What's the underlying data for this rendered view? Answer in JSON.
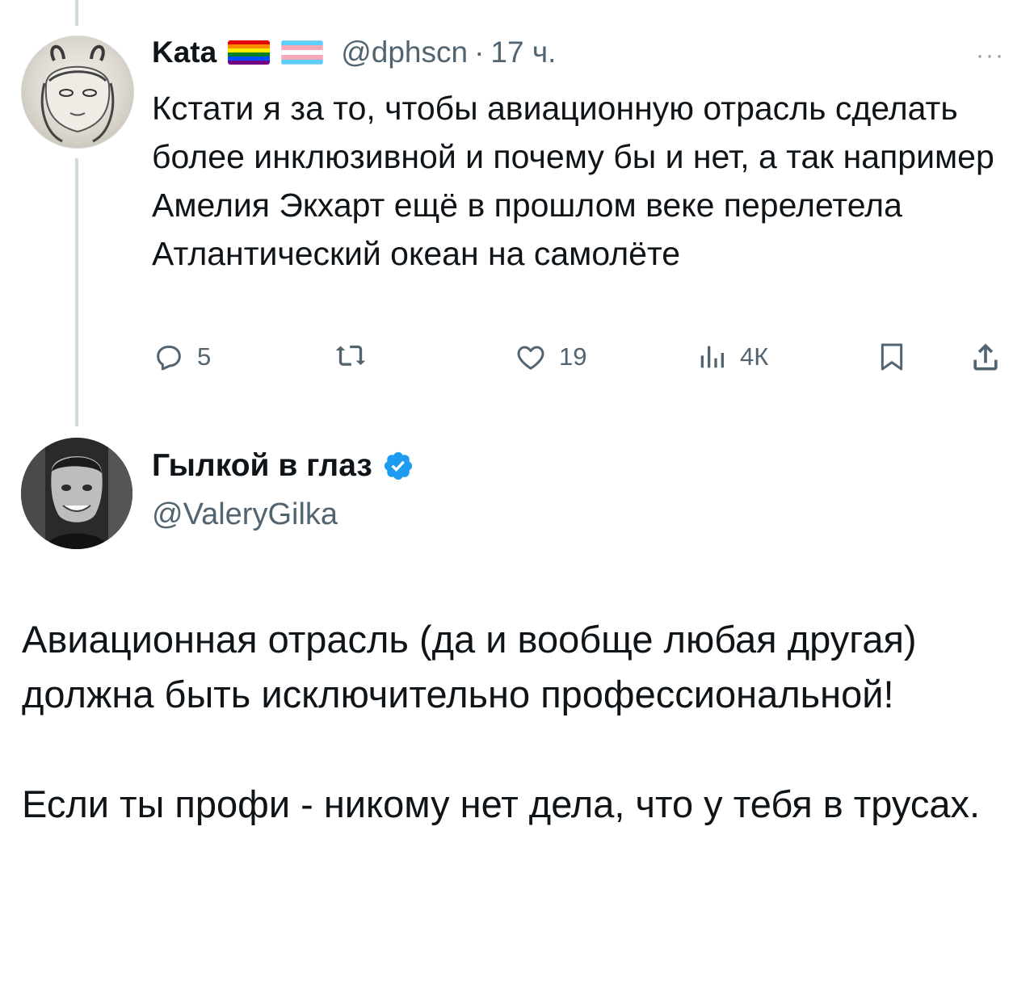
{
  "tweet1": {
    "name": "Kata",
    "flags": [
      "rainbow-flag",
      "transgender-flag"
    ],
    "handle": "@dphscn",
    "separator": "·",
    "time": "17 ч.",
    "more": "···",
    "text": "Кстати я за то, чтобы авиационную отрасль сделать более инклюзивной и почему бы и нет, а так например Амелия Экхарт ещё в прошлом веке перелетела Атлантический океан на самолёте",
    "replies": "5",
    "likes": "19",
    "views": "4К"
  },
  "tweet2": {
    "name": "Гылкой в глаз",
    "handle": "@ValeryGilka",
    "paragraph1": "Авиационная отрасль (да и вообще любая другая) должна быть исключительно профессиональной!",
    "paragraph2": "Если ты профи - никому нет дела, что у тебя в трусах."
  },
  "colors": {
    "text": "#0f1419",
    "secondary": "#536471",
    "verified": "#1d9bf0",
    "thread_line": "#cfd9de"
  },
  "icons": [
    "reply-icon",
    "retweet-icon",
    "like-icon",
    "views-icon",
    "bookmark-icon",
    "share-icon",
    "verified-badge-icon",
    "more-icon"
  ]
}
